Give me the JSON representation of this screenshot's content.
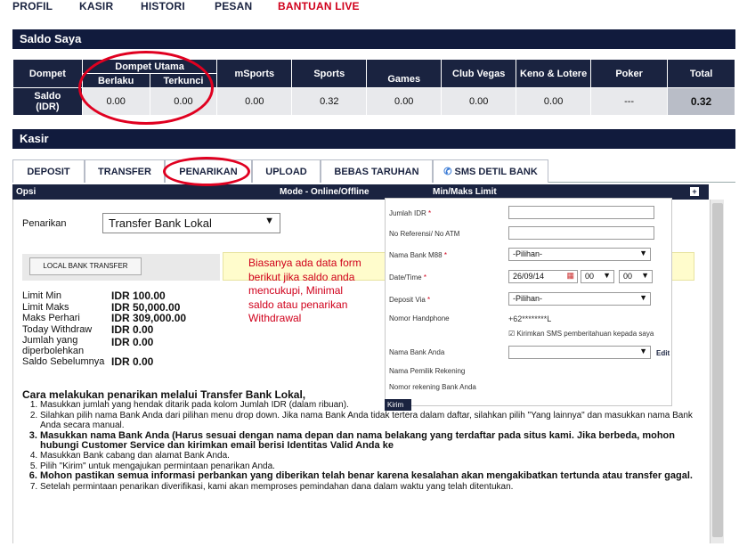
{
  "nav": {
    "items": [
      "PROFIL",
      "KASIR",
      "HISTORI",
      "PESAN",
      "BANTUAN LIVE"
    ]
  },
  "saldo": {
    "title": "Saldo Saya",
    "headers": {
      "dompet": "Dompet",
      "dompet_utama": "Dompet Utama",
      "berlaku": "Berlaku",
      "terkunci": "Terkunci",
      "msports": "mSports",
      "sports": "Sports",
      "games": "Games",
      "clubvegas": "Club Vegas",
      "keno": "Keno & Lotere",
      "poker": "Poker",
      "total": "Total"
    },
    "row_label_1": "Saldo",
    "row_label_2": "(IDR)",
    "values": {
      "berlaku": "0.00",
      "terkunci": "0.00",
      "msports": "0.00",
      "sports": "0.32",
      "games": "0.00",
      "clubvegas": "0.00",
      "keno": "0.00",
      "poker": "---",
      "total": "0.32"
    }
  },
  "kasir": {
    "title": "Kasir",
    "tabs": [
      "DEPOSIT",
      "TRANSFER",
      "PENARIKAN",
      "UPLOAD",
      "BEBAS TARUHAN",
      "SMS DETIL BANK"
    ],
    "active_tab": "PENARIKAN"
  },
  "opsi": {
    "col1": "Opsi",
    "col2": "Mode - Online/Offline",
    "col3": "Min/Maks Limit"
  },
  "penarikan": {
    "label": "Penarikan",
    "selected": "Transfer Bank Lokal",
    "button": "LOCAL BANK TRANSFER",
    "limits": [
      {
        "k": "Limit Min",
        "v": "IDR 100.00"
      },
      {
        "k": "Limit Maks",
        "v": "IDR 50,000.00"
      },
      {
        "k": "Maks Perhari",
        "v": "IDR 309,000.00"
      },
      {
        "k": "Today Withdraw",
        "v": "IDR 0.00"
      },
      {
        "k": "Jumlah yang diperbolehkan",
        "v": "IDR 0.00"
      },
      {
        "k": "Saldo Sebelumnya",
        "v": "IDR 0.00"
      }
    ]
  },
  "note": "Biasanya ada data form berikut jika saldo anda mencukupi, Minimal saldo atau penarikan Withdrawal",
  "form": {
    "jumlah": "Jumlah IDR",
    "referensi": "No Referensi/ No ATM",
    "bank_m88": "Nama Bank M88",
    "bank_m88_value": "-Pilihan-",
    "date": "Date/Time",
    "date_value": "26/09/14",
    "hour": "00",
    "minute": "00",
    "deposit_via": "Deposit Via",
    "deposit_via_value": "-Pilihan-",
    "phone": "Nomor Handphone",
    "phone_value": "+62********L",
    "sms_check": "Kirimkan SMS pemberitahuan kepada saya",
    "bank_anda": "Nama Bank Anda",
    "edit": "Edit",
    "pemilik": "Nama Pemilik Rekening",
    "nomor_rek": "Nomor rekening Bank Anda",
    "kirim": "Kirim"
  },
  "instructions": {
    "title": "Cara melakukan penarikan melalui Transfer Bank Lokal,",
    "steps": [
      "Masukkan jumlah yang hendak ditarik pada kolom Jumlah IDR (dalam ribuan).",
      "Silahkan pilih nama Bank Anda dari pilihan menu drop down. Jika nama Bank Anda tidak tertera dalam daftar, silahkan pilih \"Yang lainnya\" dan masukkan nama Bank Anda secara manual.",
      "Masukkan nama Bank Anda (Harus sesuai dengan nama depan dan nama belakang yang terdaftar pada situs kami. Jika berbeda, mohon hubungi Customer Service dan kirimkan email berisi Identitas Valid Anda ke",
      "Masukkan Bank cabang dan alamat Bank Anda.",
      "Pilih \"Kirim\" untuk mengajukan permintaan penarikan Anda.",
      "Mohon pastikan semua informasi perbankan yang diberikan telah benar karena kesalahan akan mengakibatkan tertunda atau transfer gagal.",
      "Setelah permintaan penarikan diverifikasi, kami akan memproses pemindahan dana dalam waktu yang telah ditentukan."
    ]
  },
  "colors": {
    "navy": "#1a2340",
    "accent_red": "#d0001b",
    "highlight_red": "#e00020"
  }
}
